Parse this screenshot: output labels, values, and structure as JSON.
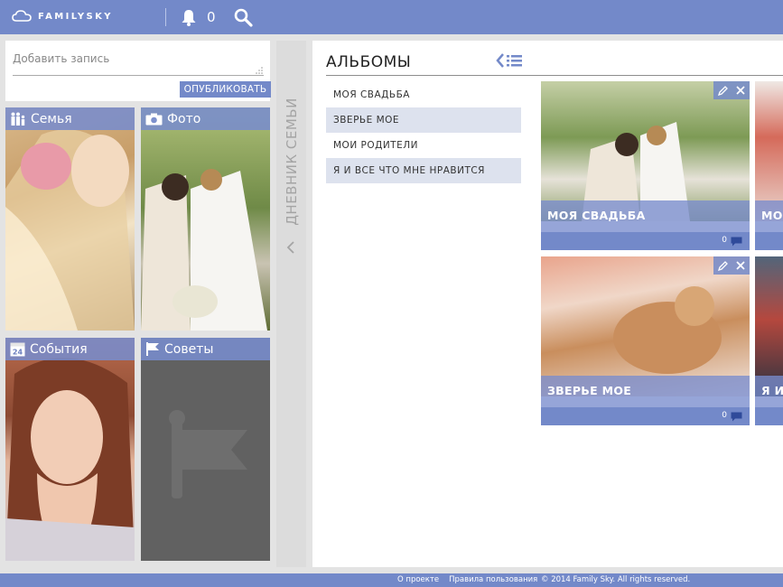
{
  "header": {
    "logo_text": "FAMILYSKY",
    "notification_count": "0"
  },
  "post": {
    "placeholder": "Добавить запись",
    "publish_label": "ОПУБЛИКОВАТЬ"
  },
  "tiles": {
    "family": "Семья",
    "photo": "Фото",
    "events": "События",
    "tips": "Советы"
  },
  "diary": {
    "label": "ДНЕВНИК СЕМЬИ"
  },
  "albums": {
    "title": "АЛЬБОМЫ",
    "list": [
      "МОЯ СВАДЬБА",
      "ЗВЕРЬЕ МОЕ",
      "МОИ РОДИТЕЛИ",
      "Я И ВСЕ ЧТО МНЕ НРАВИТСЯ"
    ],
    "cards": [
      {
        "title": "МОЯ СВАДЬБА",
        "comments": "0"
      },
      {
        "title": "ЗВЕРЬЕ МОЕ",
        "comments": "0"
      },
      {
        "title": "МО"
      },
      {
        "title": "Я И"
      }
    ]
  },
  "footer": {
    "about": "О проекте",
    "rules": "Правила пользования",
    "copyright": "© 2014 Family Sky. All rights reserved."
  },
  "colors": {
    "accent": "#7389c9",
    "list_alt": "#dde2ee"
  }
}
